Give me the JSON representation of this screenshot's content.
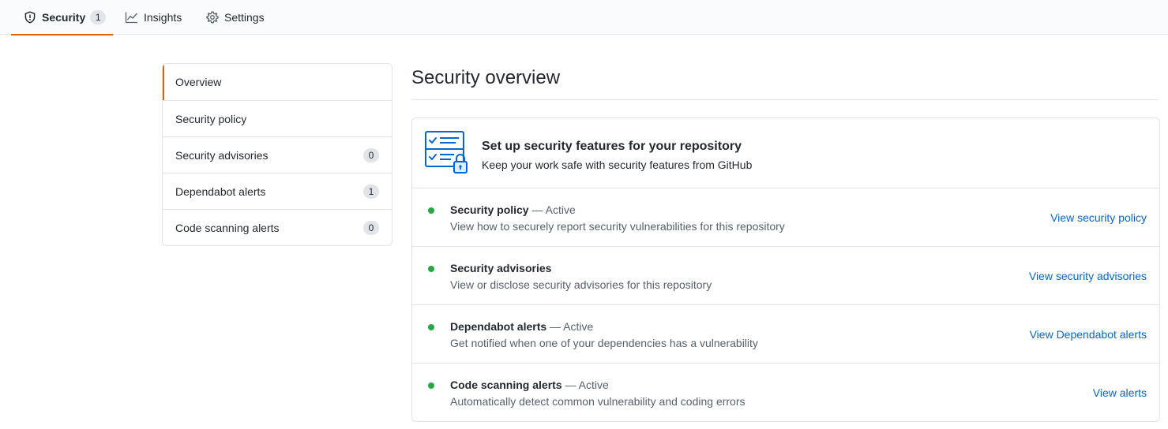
{
  "tabs": [
    {
      "label": "Security",
      "counter": "1",
      "icon": "shield-icon"
    },
    {
      "label": "Insights",
      "icon": "graph-icon"
    },
    {
      "label": "Settings",
      "icon": "gear-icon"
    }
  ],
  "sidebar": {
    "items": [
      {
        "label": "Overview",
        "selected": true
      },
      {
        "label": "Security policy"
      },
      {
        "label": "Security advisories",
        "counter": "0"
      },
      {
        "label": "Dependabot alerts",
        "counter": "1"
      },
      {
        "label": "Code scanning alerts",
        "counter": "0"
      }
    ]
  },
  "main": {
    "title": "Security overview",
    "setup": {
      "title": "Set up security features for your repository",
      "subtitle": "Keep your work safe with security features from GitHub",
      "icon": "security-checklist-lock-icon"
    },
    "features": [
      {
        "name": "Security policy",
        "status": "— Active",
        "description": "View how to securely report security vulnerabilities for this repository",
        "link": "View security policy"
      },
      {
        "name": "Security advisories",
        "status": "",
        "description": "View or disclose security advisories for this repository",
        "link": "View security advisories"
      },
      {
        "name": "Dependabot alerts",
        "status": "— Active",
        "description": "Get notified when one of your dependencies has a vulnerability",
        "link": "View Dependabot alerts"
      },
      {
        "name": "Code scanning alerts",
        "status": "— Active",
        "description": "Automatically detect common vulnerability and coding errors",
        "link": "View alerts"
      }
    ]
  },
  "colors": {
    "accent_underline": "#e36209",
    "link": "#0366d6",
    "status_dot": "#28a745",
    "border": "#e1e4e8",
    "illustration_blue": "#0366d6",
    "illustration_fill": "#dbedff"
  }
}
